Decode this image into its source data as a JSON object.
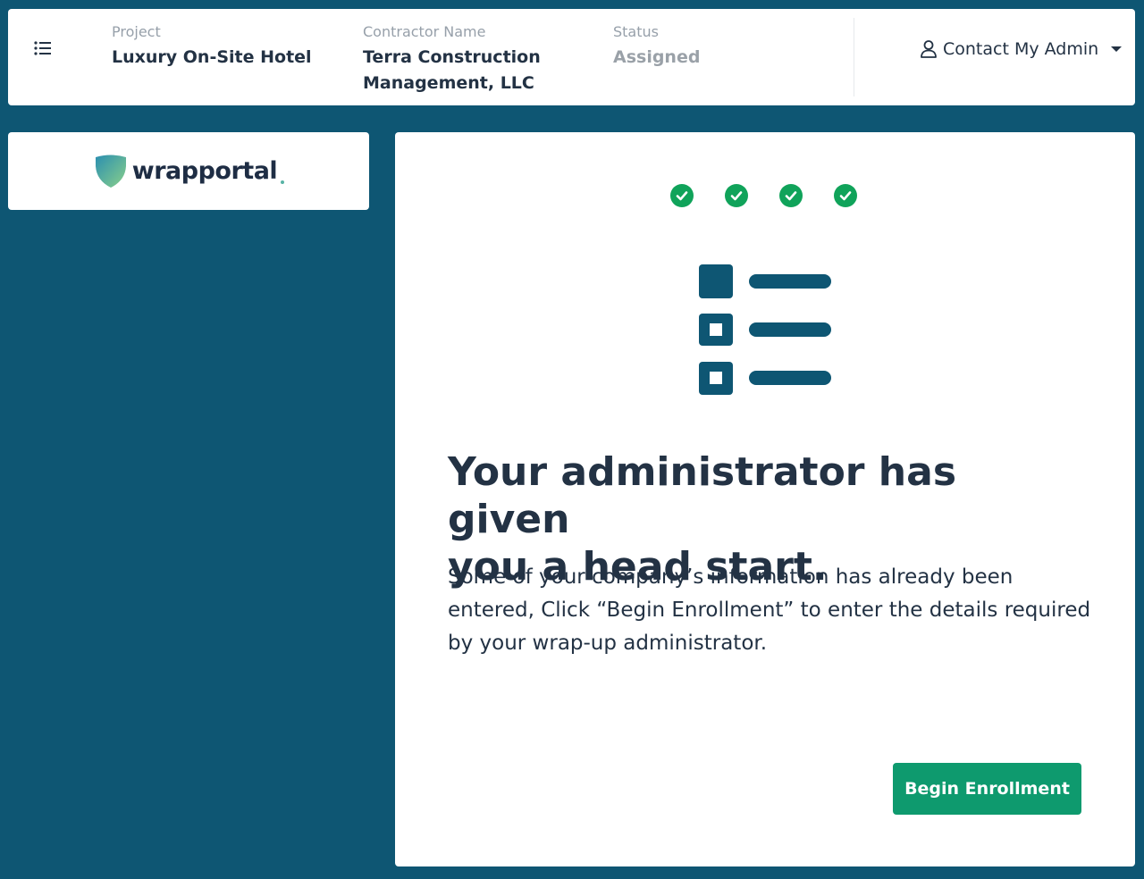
{
  "header": {
    "project": {
      "label": "Project",
      "value": "Luxury On-Site Hotel"
    },
    "contractor": {
      "label": "Contractor Name",
      "value_line1": "Terra Construction",
      "value_line2": "Management, LLC"
    },
    "status": {
      "label": "Status",
      "value": "Assigned"
    },
    "contact_label": "Contact My Admin",
    "icons": {
      "menu": "list-icon",
      "contact": "user-icon",
      "caret": "caret-down-icon"
    }
  },
  "sidebar": {
    "logo_text": "wrapportal"
  },
  "main": {
    "progress_steps_completed": 4,
    "headline_line1": "Your administrator has given",
    "headline_line2": "you a head start.",
    "description_line1": "Some of your company’s information has already been",
    "description_line2": "entered, Click “Begin Enrollment” to enter the details required",
    "description_line3": "by your wrap-up administrator.",
    "button_label": "Begin Enrollment"
  },
  "colors": {
    "background": "#0e5673",
    "accent_green": "#10a35a",
    "button_green": "#0e9a6e",
    "text_dark": "#233244"
  }
}
